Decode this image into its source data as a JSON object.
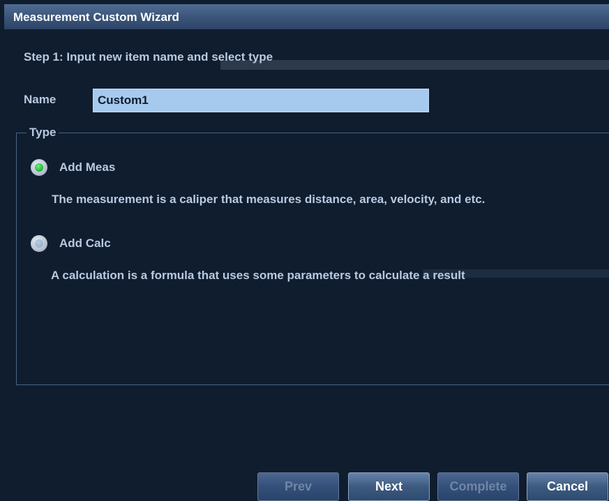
{
  "window": {
    "title": "Measurement Custom Wizard"
  },
  "step": {
    "text": "Step 1: Input new item name and select type"
  },
  "name_field": {
    "label": "Name",
    "value": "Custom1"
  },
  "type_group": {
    "legend": "Type",
    "options": [
      {
        "label": "Add Meas",
        "selected": true,
        "description": "The measurement is a caliper that measures distance, area, velocity, and etc."
      },
      {
        "label": "Add Calc",
        "selected": false,
        "description": "A calculation is a formula that uses some parameters to calculate a result"
      }
    ]
  },
  "buttons": {
    "prev": "Prev",
    "next": "Next",
    "complete": "Complete",
    "cancel": "Cancel"
  },
  "colors": {
    "background": "#0f1d2e",
    "text": "#b8c9e0",
    "input_bg": "#a6c9ee",
    "radio_selected": "#1eb435"
  }
}
